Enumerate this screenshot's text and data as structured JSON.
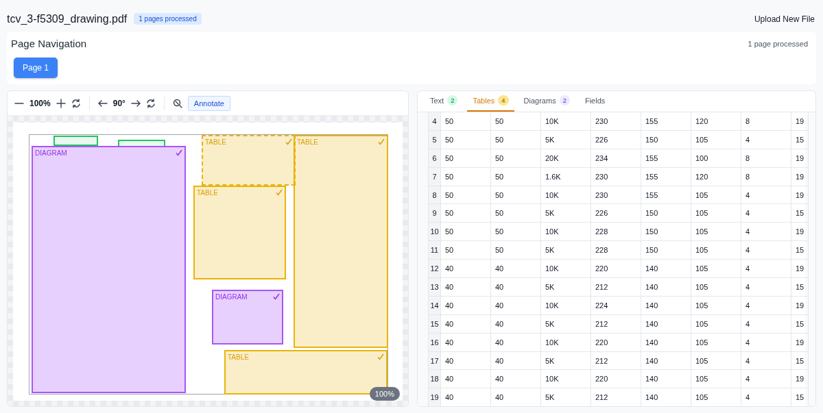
{
  "header": {
    "filename": "tcv_3-f5309_drawing.pdf",
    "badge": "1 pages processed",
    "upload_button": "Upload New File"
  },
  "page_navigation": {
    "title": "Page Navigation",
    "status": "1 page processed",
    "pages": [
      {
        "label": "Page 1",
        "selected": true
      }
    ]
  },
  "viewer": {
    "toolbar": {
      "zoom": "100%",
      "rotation": "90°",
      "annotate_button": "Annotate"
    },
    "regions": [
      {
        "kind": "text",
        "selected": false
      },
      {
        "kind": "text",
        "selected": false
      },
      {
        "kind": "diagram",
        "label": "DIAGRAM",
        "selected": false
      },
      {
        "kind": "table",
        "label": "TABLE",
        "selected": true
      },
      {
        "kind": "table",
        "label": "TABLE",
        "selected": false
      },
      {
        "kind": "table",
        "label": "TABLE",
        "selected": false
      },
      {
        "kind": "diagram",
        "label": "DIAGRAM",
        "selected": false
      },
      {
        "kind": "table",
        "label": "TABLE",
        "selected": false
      }
    ],
    "zoom_badge": "100%"
  },
  "results": {
    "tabs": [
      {
        "label": "Text",
        "count": "2",
        "kind": "text",
        "selected": false
      },
      {
        "label": "Tables",
        "count": "4",
        "kind": "table",
        "selected": true
      },
      {
        "label": "Diagrams",
        "count": "2",
        "kind": "diagram",
        "selected": false
      },
      {
        "label": "Fields",
        "kind": "field",
        "selected": false
      }
    ],
    "table": {
      "rows": [
        [
          "4",
          "50",
          "50",
          "10K",
          "230",
          "155",
          "120",
          "8",
          "19"
        ],
        [
          "5",
          "50",
          "50",
          "5K",
          "226",
          "150",
          "105",
          "4",
          "15"
        ],
        [
          "6",
          "50",
          "50",
          "20K",
          "234",
          "155",
          "100",
          "8",
          "19"
        ],
        [
          "7",
          "50",
          "50",
          "1.6K",
          "230",
          "155",
          "120",
          "8",
          "19"
        ],
        [
          "8",
          "50",
          "50",
          "10K",
          "230",
          "155",
          "105",
          "4",
          "19"
        ],
        [
          "9",
          "50",
          "50",
          "5K",
          "226",
          "150",
          "105",
          "4",
          "15"
        ],
        [
          "10",
          "50",
          "50",
          "10K",
          "228",
          "150",
          "105",
          "4",
          "19"
        ],
        [
          "11",
          "50",
          "50",
          "5K",
          "228",
          "150",
          "105",
          "4",
          "15"
        ],
        [
          "12",
          "40",
          "40",
          "10K",
          "220",
          "140",
          "105",
          "4",
          "19"
        ],
        [
          "13",
          "40",
          "40",
          "5K",
          "212",
          "140",
          "105",
          "4",
          "15"
        ],
        [
          "14",
          "40",
          "40",
          "10K",
          "224",
          "140",
          "105",
          "4",
          "19"
        ],
        [
          "15",
          "40",
          "40",
          "5K",
          "212",
          "140",
          "105",
          "4",
          "15"
        ],
        [
          "16",
          "40",
          "40",
          "10K",
          "220",
          "140",
          "105",
          "4",
          "19"
        ],
        [
          "17",
          "40",
          "40",
          "5K",
          "212",
          "140",
          "105",
          "4",
          "15"
        ],
        [
          "18",
          "40",
          "40",
          "10K",
          "220",
          "140",
          "105",
          "4",
          "19"
        ],
        [
          "19",
          "40",
          "40",
          "5K",
          "212",
          "140",
          "105",
          "4",
          "15"
        ]
      ]
    }
  }
}
